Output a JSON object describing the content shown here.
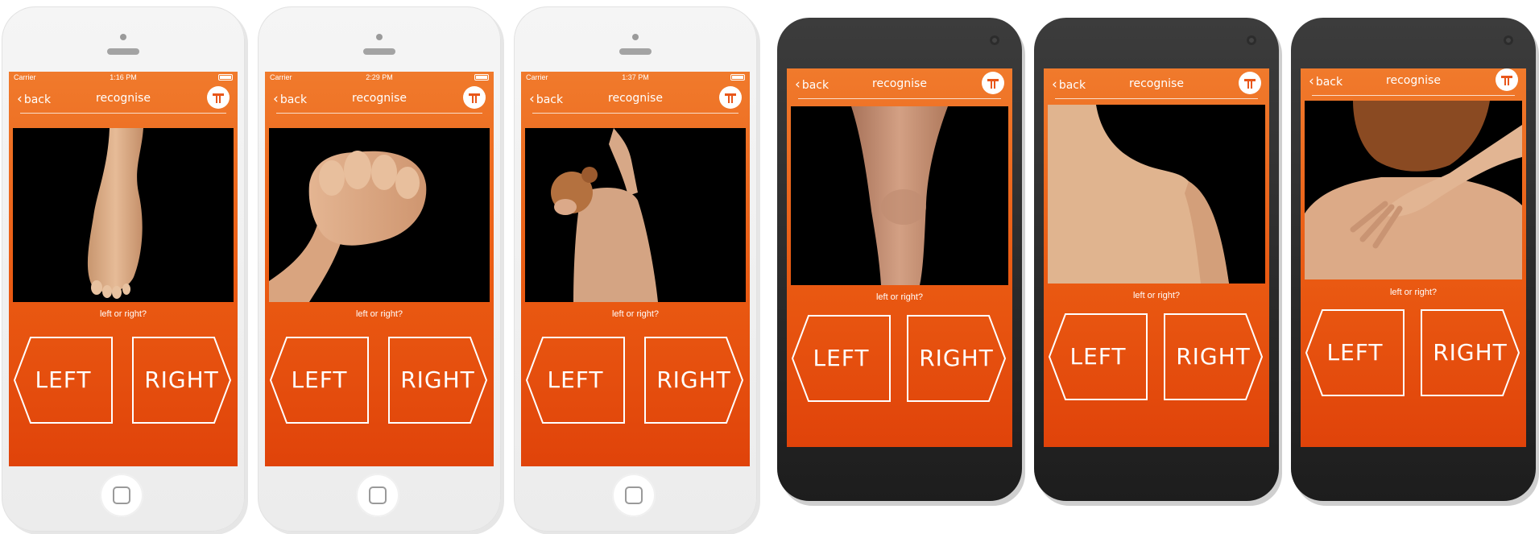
{
  "screens": [
    {
      "platform": "ios",
      "carrier": "Carrier",
      "time": "1:16 PM",
      "back_label": "back",
      "title": "recognise",
      "image": "foot-sole",
      "prompt": "left or right?",
      "left_label": "LEFT",
      "right_label": "RIGHT"
    },
    {
      "platform": "ios",
      "carrier": "Carrier",
      "time": "2:29 PM",
      "back_label": "back",
      "title": "recognise",
      "image": "clenched-fist",
      "prompt": "left or right?",
      "left_label": "LEFT",
      "right_label": "RIGHT"
    },
    {
      "platform": "ios",
      "carrier": "Carrier",
      "time": "1:37 PM",
      "back_label": "back",
      "title": "recognise",
      "image": "raised-arm-back",
      "prompt": "left or right?",
      "left_label": "LEFT",
      "right_label": "RIGHT"
    },
    {
      "platform": "android",
      "back_label": "back",
      "title": "recognise",
      "image": "knee",
      "prompt": "left or right?",
      "left_label": "LEFT",
      "right_label": "RIGHT"
    },
    {
      "platform": "android",
      "back_label": "back",
      "title": "recognise",
      "image": "shoulder",
      "prompt": "left or right?",
      "left_label": "LEFT",
      "right_label": "RIGHT"
    },
    {
      "platform": "android",
      "back_label": "back",
      "title": "recognise",
      "image": "hand-on-shoulder",
      "prompt": "left or right?",
      "left_label": "LEFT",
      "right_label": "RIGHT"
    }
  ],
  "colors": {
    "accent": "#e8561a",
    "photo_bg": "#000000",
    "skin": "#e3b48f"
  }
}
